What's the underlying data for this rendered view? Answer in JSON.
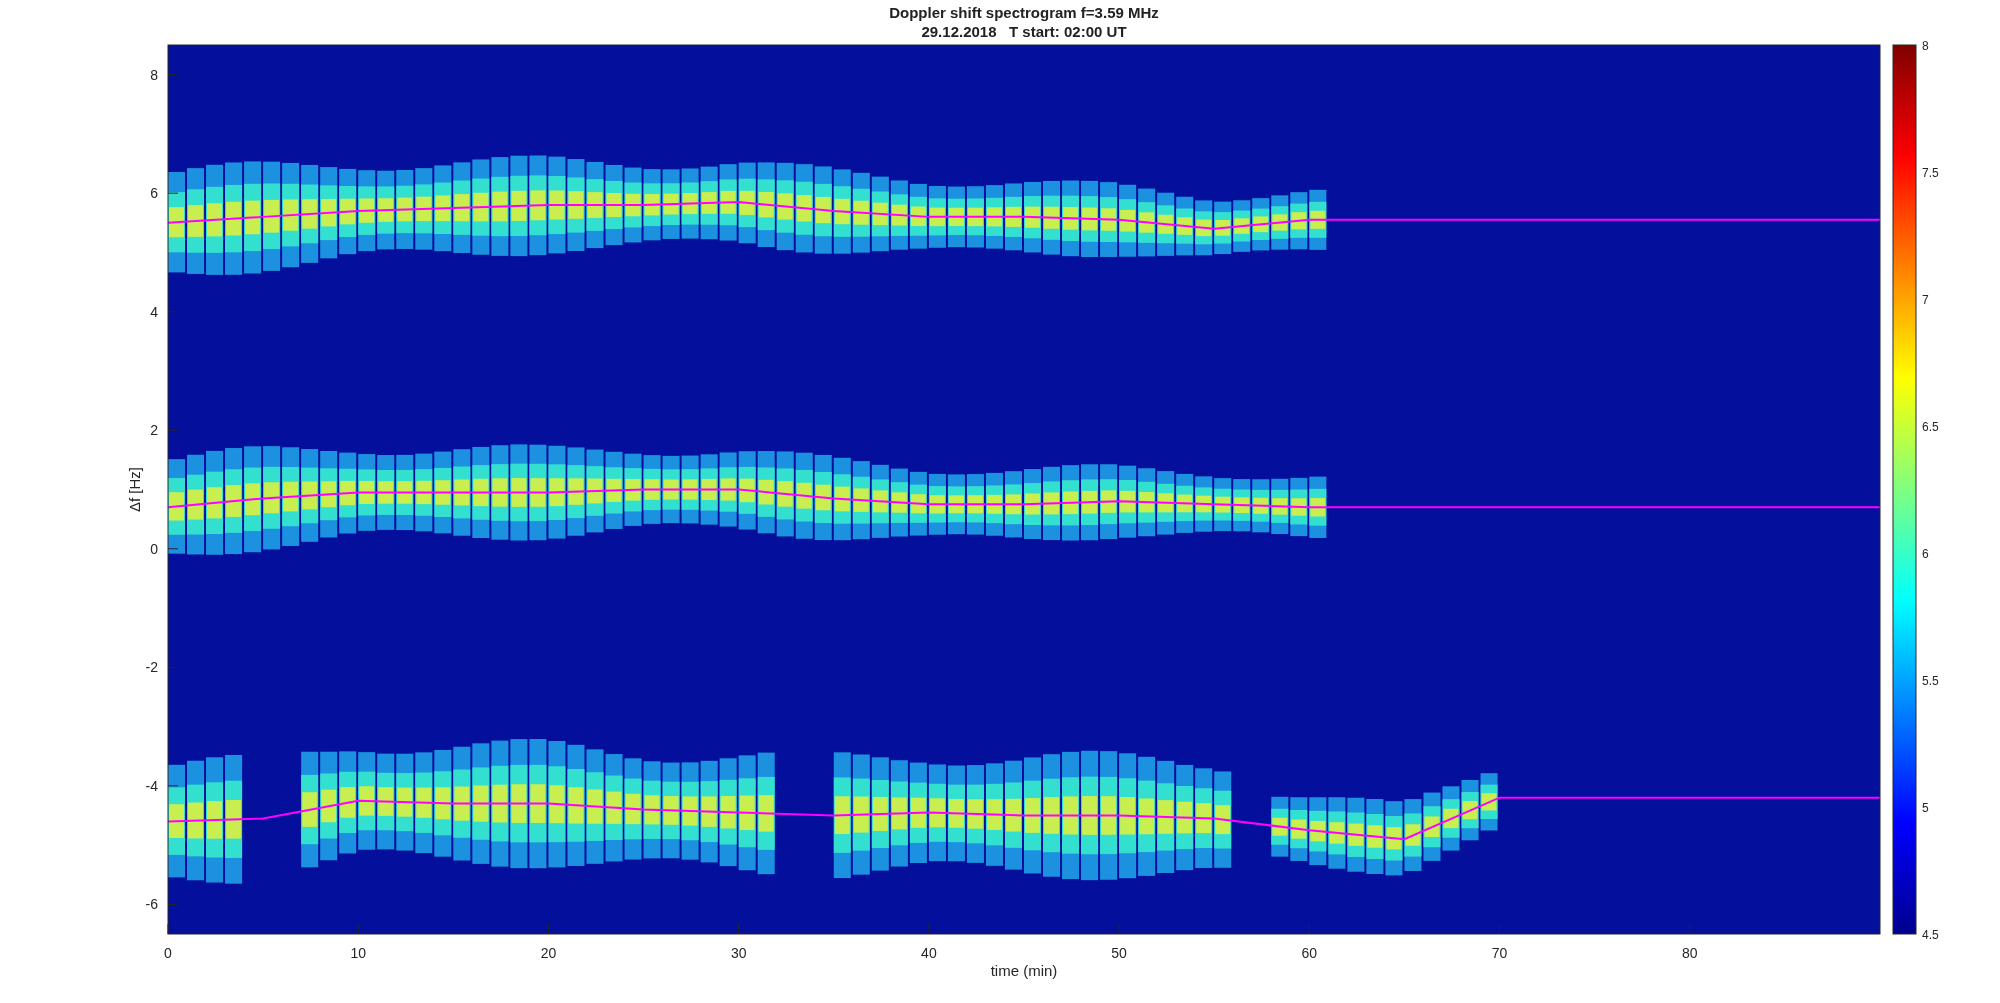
{
  "figure": {
    "chart_data": {
      "type": "line",
      "title": "Doppler shift spectrogram f=3.59 MHz",
      "subtitle": "29.12.2018   T start: 02:00 UT",
      "xlabel": "time (min)",
      "ylabel": "Δf [Hz]",
      "xlim": [
        0,
        90
      ],
      "ylim": [
        -6.5,
        8.5
      ],
      "xticks": [
        0,
        10,
        20,
        30,
        40,
        50,
        60,
        70,
        80
      ],
      "yticks": [
        -6,
        -4,
        -2,
        0,
        2,
        4,
        6,
        8
      ],
      "x": [
        0,
        5,
        10,
        15,
        20,
        25,
        30,
        35,
        40,
        45,
        50,
        55,
        60,
        65,
        70,
        75,
        80,
        85,
        90
      ],
      "series": [
        {
          "color": "#ff00ff",
          "values": [
            5.5,
            5.6,
            5.7,
            5.75,
            5.8,
            5.8,
            5.85,
            5.7,
            5.6,
            5.6,
            5.55,
            5.4,
            5.55,
            5.55,
            5.55,
            5.55,
            5.55,
            5.55,
            5.55
          ]
        },
        {
          "color": "#ff00ff",
          "values": [
            0.7,
            0.85,
            0.95,
            0.95,
            0.95,
            1.0,
            1.0,
            0.85,
            0.75,
            0.75,
            0.8,
            0.75,
            0.7,
            0.7,
            0.7,
            0.7,
            0.7,
            0.7,
            0.7
          ]
        },
        {
          "color": "#ff00ff",
          "values": [
            -4.6,
            -4.55,
            -4.25,
            -4.3,
            -4.3,
            -4.4,
            -4.45,
            -4.5,
            -4.45,
            -4.5,
            -4.5,
            -4.55,
            -4.75,
            -4.9,
            -4.2,
            -4.2,
            -4.2,
            -4.2,
            -4.2
          ]
        }
      ]
    },
    "colorbar": {
      "ticks": [
        "8",
        "7.5",
        "7",
        "6.5",
        "6",
        "5.5",
        "5",
        "4.5"
      ]
    }
  }
}
